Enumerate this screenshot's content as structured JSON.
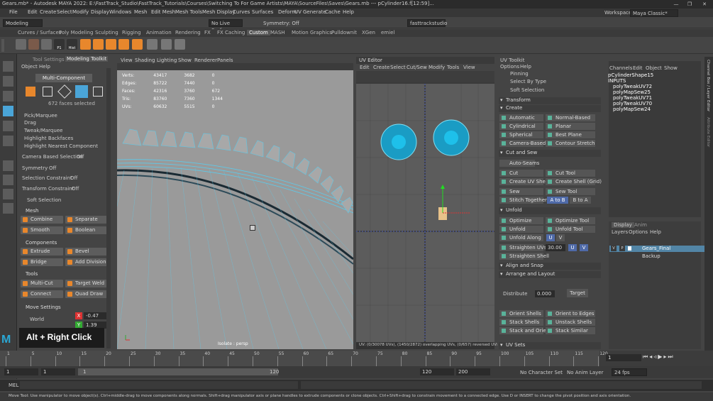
{
  "window": {
    "title": "Gears.mb* - Autodesk MAYA 2022: E:\\FastTrack_Studio\\FastTrack_Tutorials\\Courses\\Switching To For Game Artists\\MAYA\\SourceFiles\\Saves\\Gears.mb --- pCylinder16.f[12:59]...",
    "workspace_label": "Workspace :",
    "workspace_value": "Maya Classic*"
  },
  "menubar": [
    "File",
    "Edit",
    "Create",
    "Select",
    "Modify",
    "Display",
    "Windows",
    "Mesh",
    "Edit Mesh",
    "Mesh Tools",
    "Mesh Display",
    "Curves",
    "Surfaces",
    "Deform",
    "UV",
    "Generate",
    "Cache",
    "Help"
  ],
  "statusline": {
    "mode": "Modeling",
    "live_surface": "No Live Surface",
    "symmetry": "Symmetry: Off",
    "set_name": "fasttrackstudio"
  },
  "shelf_tabs": [
    "Curves / Surfaces",
    "Poly Modeling",
    "Sculpting",
    "Rigging",
    "Animation",
    "Rendering",
    "FX",
    "FX Caching",
    "Custom",
    "MASH",
    "Motion Graphics",
    "Pulldownit",
    "XGen",
    "emiel"
  ],
  "shelf_active": "Custom",
  "shelf_labels": {
    "p1": "P1",
    "hist": "Hist"
  },
  "toolpanel": {
    "tabs": [
      "Tool Settings",
      "Modeling Toolkit"
    ],
    "menu": [
      "Object",
      "Help"
    ],
    "mode_button": "Multi-Component",
    "selection_info": "672 faces selected",
    "options": [
      "Pick/Marquee",
      "Drag",
      "Tweak/Marquee",
      "Highlight Backfaces",
      "Highlight Nearest Component"
    ],
    "camera_based_selection": {
      "label": "Camera Based Selection",
      "value": "Off"
    },
    "symmetry": {
      "label": "Symmetry",
      "value": "Off"
    },
    "selection_constraint": {
      "label": "Selection Constraint",
      "value": "Off"
    },
    "transform_constraint": {
      "label": "Transform Constraint",
      "value": "Off"
    },
    "soft_selection": "Soft Selection",
    "mesh_header": "Mesh",
    "mesh_buttons": [
      "Combine",
      "Separate",
      "Smooth",
      "Boolean"
    ],
    "components_header": "Components",
    "component_buttons": [
      "Extrude",
      "Bevel",
      "Bridge",
      "Add Divisions"
    ],
    "tools_header": "Tools",
    "tool_buttons": [
      "Multi-Cut",
      "Target Weld",
      "Connect",
      "Quad Draw"
    ],
    "move_header": "Move Settings",
    "world_label": "World",
    "x_label": "X",
    "x_value": "-0.47",
    "y_label": "Y",
    "y_value": "1.39"
  },
  "overlay_text": "Alt + Right Click",
  "viewport": {
    "menu": [
      "View",
      "Shading",
      "Lighting",
      "Show",
      "Renderer",
      "Panels"
    ],
    "hud": [
      {
        "label": "Verts:",
        "a": "43417",
        "b": "3682",
        "c": "0"
      },
      {
        "label": "Edges:",
        "a": "85722",
        "b": "7440",
        "c": "0"
      },
      {
        "label": "Faces:",
        "a": "42316",
        "b": "3760",
        "c": "672"
      },
      {
        "label": "Tris:",
        "a": "83760",
        "b": "7360",
        "c": "1344"
      },
      {
        "label": "UVs:",
        "a": "60632",
        "b": "5515",
        "c": "0"
      }
    ],
    "camera_label": "Isolate : persp"
  },
  "uv_editor": {
    "title": "UV Editor",
    "menu": [
      "Edit",
      "Create",
      "Select",
      "Cut/Sew",
      "Modify",
      "Tools",
      "View"
    ],
    "status": "UV: (0/30078 UVs), (1450/2872) overlapping UVs, (0/657) reversed UVs"
  },
  "uv_toolkit": {
    "title": "UV Toolkit",
    "menu": [
      "Options",
      "Help"
    ],
    "top_items": [
      "Pinning",
      "Select By Type",
      "Soft Selection"
    ],
    "transform": "Transform",
    "create": "Create",
    "create_buttons": [
      "Automatic",
      "Normal-Based",
      "Cylindrical",
      "Planar",
      "Spherical",
      "Best Plane",
      "Camera-Based",
      "Contour Stretch"
    ],
    "cut_sew": "Cut and Sew",
    "auto_seams": "Auto-Seams",
    "cut_buttons": [
      "Cut",
      "Cut Tool",
      "Create UV Shell",
      "Create Shell (Grid)",
      "Sew",
      "Sew Tool",
      "Stitch Together",
      "A to B",
      "B to A"
    ],
    "unfold": "Unfold",
    "unfold_buttons": [
      "Optimize",
      "Optimize Tool",
      "Unfold",
      "Unfold Tool",
      "Unfold Along",
      "U",
      "V"
    ],
    "straighten_uvs": "Straighten UVs",
    "straighten_value": "30.00",
    "straighten_shell": "Straighten Shell",
    "align_snap": "Align and Snap",
    "arrange_layout": "Arrange and Layout",
    "distribute": "Distribute",
    "distribute_value": "0.000",
    "target": "Target",
    "shell_buttons": [
      "Orient Shells",
      "Orient to Edges",
      "Stack Shells",
      "Unstack Shells",
      "Stack and Orient",
      "Stack Similar"
    ],
    "uv_sets": "UV Sets"
  },
  "channel_box": {
    "menu": [
      "Channels",
      "Edit",
      "Object",
      "Show"
    ],
    "object": "pCylinderShape15",
    "inputs_label": "INPUTS",
    "inputs": [
      "polyTweakUV72",
      "polyMapSew25",
      "polyTweakUV71",
      "polyTweakUV70",
      "polyMapSew24"
    ],
    "tabs": [
      "Display",
      "Anim"
    ],
    "layer_menu": [
      "Layers",
      "Options",
      "Help"
    ],
    "layers": [
      {
        "v": "V",
        "p": "P",
        "name": "Gears_Final",
        "selected": true
      },
      {
        "v": "",
        "p": "",
        "name": "Backup",
        "selected": false
      }
    ]
  },
  "right_strip": [
    "Channel Box / Layer Editor",
    "Attribute Editor"
  ],
  "timeline": {
    "ticks": [
      "1",
      "5",
      "10",
      "15",
      "20",
      "25",
      "30",
      "35",
      "40",
      "45",
      "50",
      "55",
      "60",
      "65",
      "70",
      "75",
      "80",
      "85",
      "90",
      "95",
      "100",
      "105",
      "110",
      "115",
      "120"
    ],
    "current_frame": "1"
  },
  "range": {
    "start": "1",
    "playback_start": "1",
    "slider_start": "1",
    "slider_end": "120",
    "playback_end": "120",
    "end": "200",
    "character_set": "No Character Set",
    "anim_layer": "No Anim Layer",
    "fps": "24 fps"
  },
  "cmd_label": "MEL",
  "help_line": "Move Tool: Use manipulator to move object(s). Ctrl+middle-drag to move components along normals. Shift+drag manipulator axis or plane handles to extrude components or clone objects. Ctrl+Shift+drag to constrain movement to a connected edge. Use D or INSERT to change the pivot position and axis orientation."
}
